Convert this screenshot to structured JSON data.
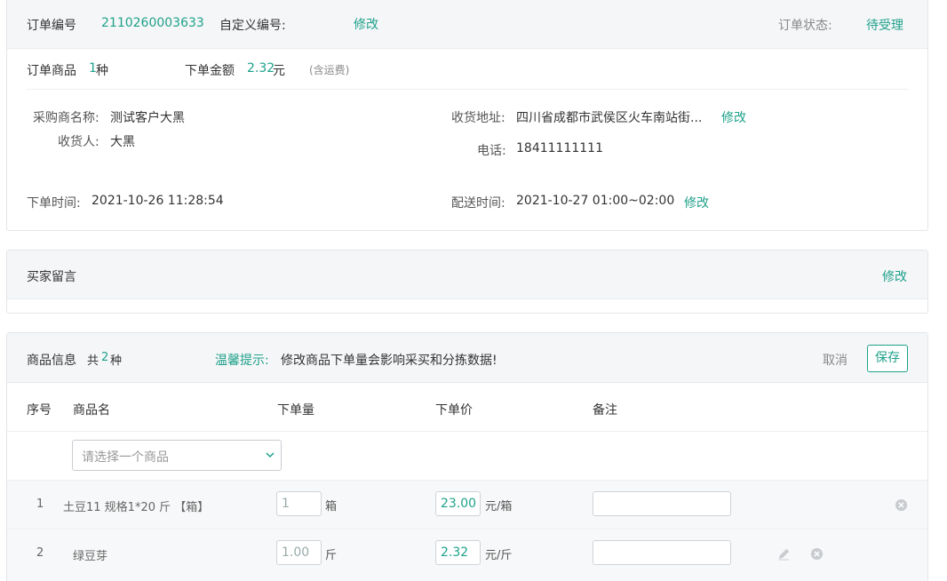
{
  "order": {
    "id_label": "订单编号",
    "id_value": "2110260003633",
    "custom_id_label": "自定义编号:",
    "edit": "修改",
    "status_label": "订单状态:",
    "status_value": "待受理",
    "goods_label": "订单商品",
    "goods_count": "1",
    "goods_unit": "种",
    "amount_label": "下单金额",
    "amount_value": "2.32",
    "amount_unit": "元",
    "amount_note": "(含运费)",
    "buyer_label": "采购商名称:",
    "buyer_value": "测试客户大黑",
    "receiver_label": "收货人:",
    "receiver_value": "大黑",
    "address_label": "收货地址:",
    "address_value": "四川省成都市武侯区火车南站街...",
    "phone_label": "电话:",
    "phone_value": "18411111111",
    "order_time_label": "下单时间:",
    "order_time_value": "2021-10-26 11:28:54",
    "delivery_time_label": "配送时间:",
    "delivery_time_value": "2021-10-27 01:00~02:00"
  },
  "remark": {
    "title": "买家留言",
    "edit": "修改"
  },
  "goods": {
    "title": "商品信息",
    "total_prefix": "共",
    "total_count": "2",
    "total_unit": "种",
    "tip_label": "温馨提示:",
    "tip_text": "修改商品下单量会影响采买和分拣数据!",
    "cancel": "取消",
    "save": "保存",
    "columns": [
      "序号",
      "商品名",
      "下单量",
      "下单价",
      "备注"
    ],
    "select_placeholder": "请选择一个商品",
    "rows": [
      {
        "index": "1",
        "name": "土豆11 规格1*20 斤 【箱】",
        "qty": "1",
        "qty_unit": "箱",
        "price": "23.00",
        "price_unit": "元/箱",
        "note": ""
      },
      {
        "index": "2",
        "name": "绿豆芽",
        "qty": "1.00",
        "qty_unit": "斤",
        "price": "2.32",
        "price_unit": "元/斤",
        "note": ""
      }
    ]
  },
  "icons": {
    "chevron": "chevron-down-icon",
    "remove": "close-circle-icon",
    "edit": "pencil-icon"
  },
  "colors": {
    "accent": "#1ea18a",
    "header_bg": "#f5f6f8"
  }
}
